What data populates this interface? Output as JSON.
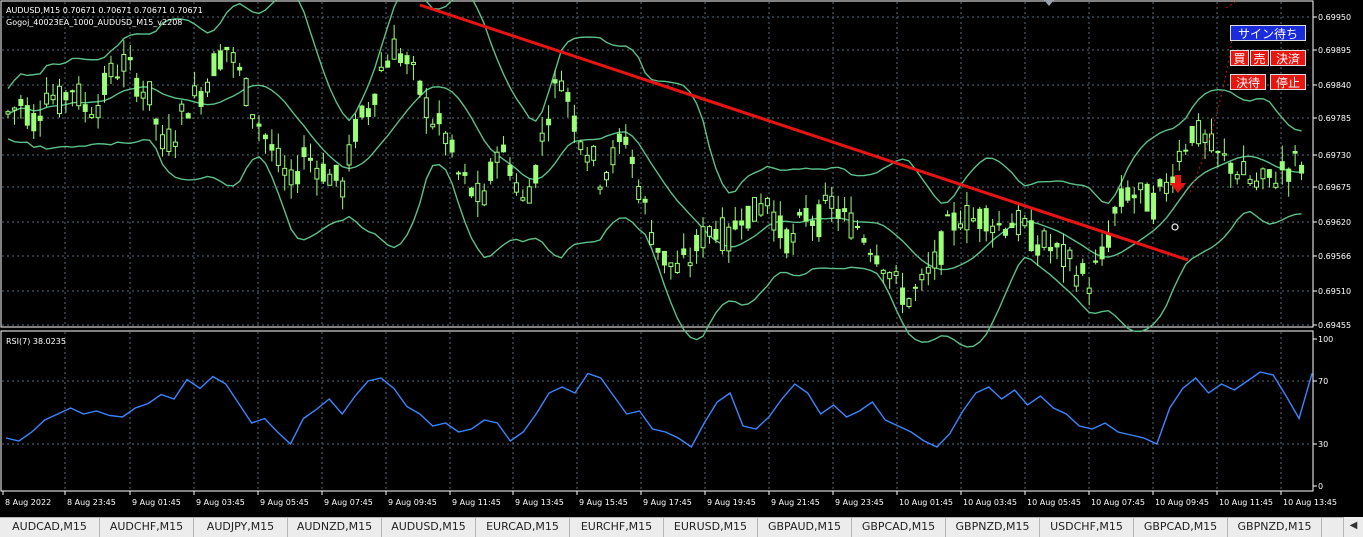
{
  "header": {
    "symbol_line": "AUDUSD,M15  0.70671 0.70671 0.70671 0.70671",
    "ea_line": "Gogoj_40023EA_1000_AUDUSD_M15_v2208"
  },
  "rsi_label": "RSI(7) 38.0235",
  "buttons": {
    "sign_wait": "サイン待ち",
    "buy": "買",
    "sell": "売",
    "settle": "決済",
    "settle_wait": "決待",
    "stop": "停止"
  },
  "colors": {
    "candle": "#9bff77",
    "bands": "#5cc08a",
    "trendline": "#e81414",
    "rsi_line": "#3a86ff",
    "grid": "#5a6a78",
    "button_blue": "#1a2bdc",
    "button_red": "#e8160f"
  },
  "chart_data": [
    {
      "type": "candlestick",
      "symbol": "AUDUSD",
      "timeframe": "M15",
      "y_tick_labels": [
        "0.69950",
        "0.69895",
        "0.69840",
        "0.69785",
        "0.69730",
        "0.69675",
        "0.69620",
        "0.69566",
        "0.69510",
        "0.69455"
      ],
      "x_tick_labels": [
        "8 Aug 2022",
        "8 Aug 23:45",
        "9 Aug 01:45",
        "9 Aug 03:45",
        "9 Aug 05:45",
        "9 Aug 07:45",
        "9 Aug 09:45",
        "9 Aug 11:45",
        "9 Aug 13:45",
        "9 Aug 15:45",
        "9 Aug 17:45",
        "9 Aug 19:45",
        "9 Aug 21:45",
        "9 Aug 23:45",
        "10 Aug 01:45",
        "10 Aug 03:45",
        "10 Aug 05:45",
        "10 Aug 07:45",
        "10 Aug 09:45",
        "10 Aug 11:45",
        "10 Aug 13:45"
      ],
      "ylim": [
        0.6943,
        0.7001
      ],
      "close_path": [
        0.6981,
        0.6983,
        0.698,
        0.6985,
        0.6983,
        0.6986,
        0.6982,
        0.6983,
        0.6988,
        0.699,
        0.6987,
        0.6984,
        0.6975,
        0.6978,
        0.6983,
        0.6985,
        0.699,
        0.6993,
        0.6988,
        0.6982,
        0.6977,
        0.6972,
        0.6968,
        0.6974,
        0.6972,
        0.697,
        0.6968,
        0.6978,
        0.6982,
        0.6989,
        0.6993,
        0.699,
        0.6985,
        0.698,
        0.6977,
        0.697,
        0.6967,
        0.6965,
        0.6975,
        0.6972,
        0.6965,
        0.6971,
        0.6982,
        0.6988,
        0.698,
        0.6975,
        0.697,
        0.6973,
        0.6977,
        0.6968,
        0.696,
        0.6955,
        0.6953,
        0.6955,
        0.6959,
        0.6961,
        0.6958,
        0.6964,
        0.6963,
        0.6966,
        0.696,
        0.6958,
        0.6963,
        0.6962,
        0.6965,
        0.6962,
        0.6961,
        0.6958,
        0.6955,
        0.695,
        0.6948,
        0.695,
        0.6954,
        0.696,
        0.6963,
        0.6962,
        0.6963,
        0.6961,
        0.6962,
        0.696,
        0.6958,
        0.6957,
        0.6955,
        0.6953,
        0.6951,
        0.6955,
        0.6963,
        0.6967,
        0.6966,
        0.6965,
        0.6968,
        0.6974,
        0.6978,
        0.6976,
        0.6973,
        0.6972,
        0.697,
        0.6968,
        0.6969,
        0.6971,
        0.6972
      ]
    },
    {
      "type": "line",
      "name": "RSI(7)",
      "y_tick_labels": [
        "100",
        "70",
        "30",
        "0"
      ],
      "ylim": [
        0,
        100
      ],
      "values": [
        32,
        30,
        36,
        44,
        48,
        52,
        48,
        50,
        47,
        46,
        52,
        55,
        61,
        58,
        71,
        65,
        73,
        68,
        55,
        42,
        45,
        36,
        28,
        45,
        51,
        58,
        48,
        60,
        70,
        72,
        65,
        53,
        48,
        40,
        42,
        36,
        38,
        44,
        42,
        30,
        36,
        48,
        62,
        66,
        62,
        75,
        72,
        60,
        48,
        50,
        38,
        36,
        32,
        26,
        42,
        56,
        62,
        40,
        38,
        46,
        58,
        68,
        62,
        48,
        54,
        46,
        50,
        56,
        44,
        40,
        36,
        30,
        26,
        35,
        50,
        62,
        66,
        58,
        64,
        54,
        60,
        52,
        48,
        40,
        38,
        42,
        36,
        34,
        32,
        28,
        52,
        65,
        72,
        62,
        68,
        64,
        70,
        76,
        74,
        60,
        45,
        75
      ]
    }
  ],
  "tabs": [
    "AUDCAD,M15",
    "AUDCHF,M15",
    "AUDJPY,M15",
    "AUDNZD,M15",
    "AUDUSD,M15",
    "EURCAD,M15",
    "EURCHF,M15",
    "EURUSD,M15",
    "GBPAUD,M15",
    "GBPCAD,M15",
    "GBPNZD,M15",
    "USDCHF,M15",
    "GBPCAD,M15",
    "GBPNZD,M15"
  ]
}
